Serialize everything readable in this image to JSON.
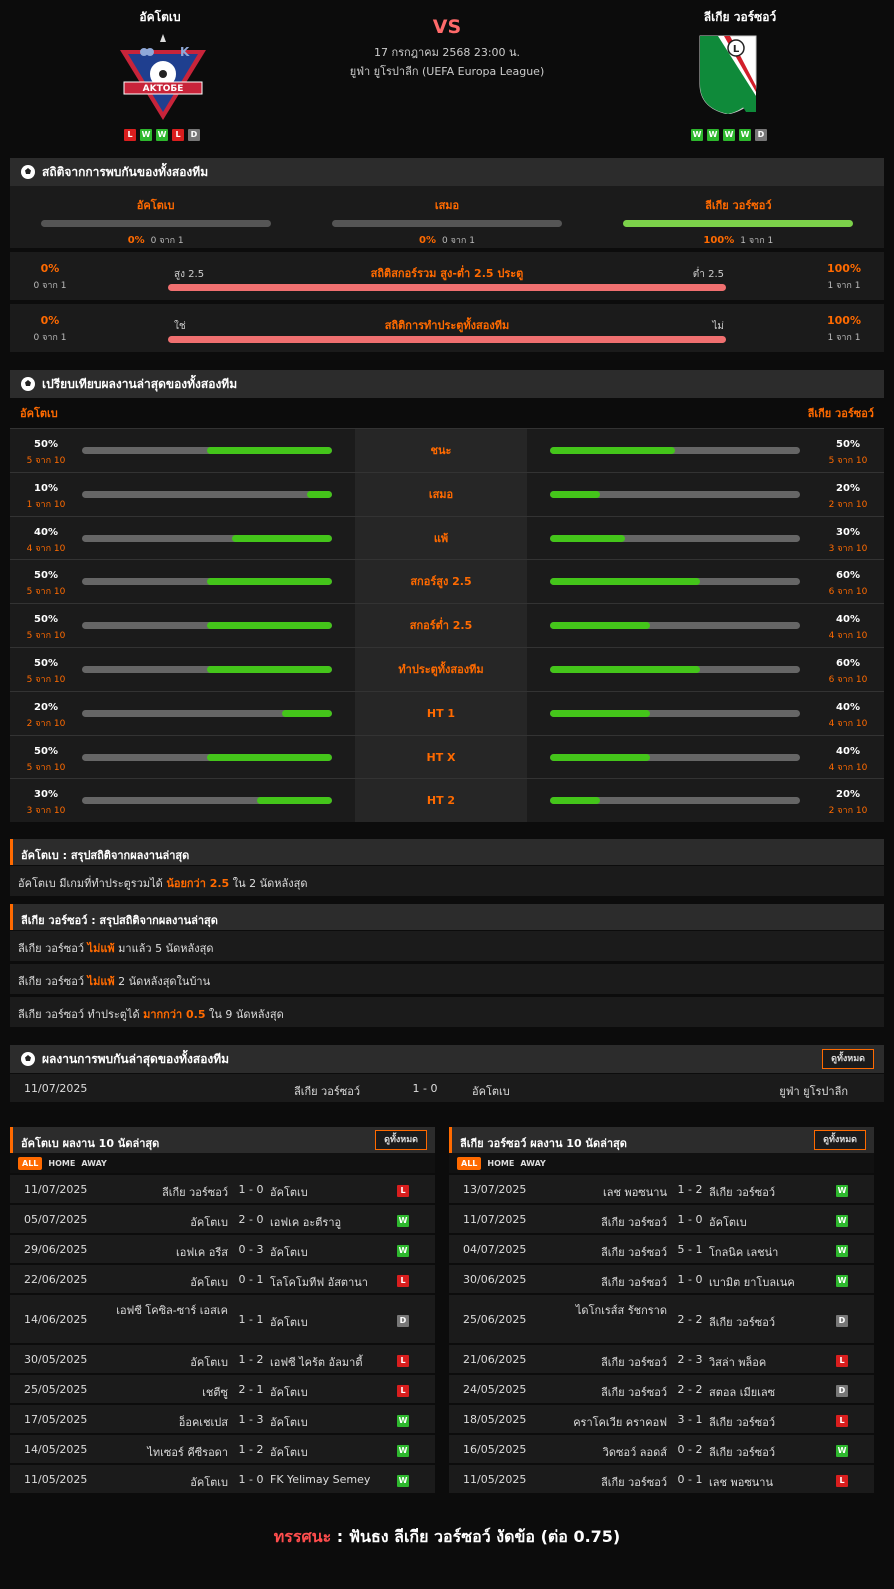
{
  "header": {
    "home_name": "อัคโตเบ",
    "away_name": "ลีเกีย วอร์ซอว์",
    "vs": "VS",
    "date": "17 กรกฎาคม 2568 23:00 น.",
    "league": "ยูฟ่า ยูโรปาลีก (UEFA Europa League)",
    "home_logo_text": "AKTOБE",
    "home_logo_letter": "K",
    "away_logo_letter": "L",
    "home_form": [
      "L",
      "W",
      "W",
      "L",
      "D"
    ],
    "away_form": [
      "W",
      "W",
      "W",
      "W",
      "D"
    ]
  },
  "h2h": {
    "title": "สถิติจากการพบกันของทั้งสองทีม",
    "cols": [
      {
        "label": "อัคโตเบ",
        "pct": "0%",
        "sub": "0 จาก 1",
        "fill": 0
      },
      {
        "label": "เสมอ",
        "pct": "0%",
        "sub": "0 จาก 1",
        "fill": 0
      },
      {
        "label": "ลีเกีย วอร์ซอว์",
        "pct": "100%",
        "sub": "1 จาก 1",
        "fill": 1
      }
    ],
    "goals": {
      "title": "สถิติสกอร์รวม สูง-ต่ำ 2.5 ประตู",
      "left_pct": "0%",
      "left_sub": "0 จาก 1",
      "left_label": "สูง 2.5",
      "right_pct": "100%",
      "right_sub": "1 จาก 1",
      "right_label": "ต่ำ 2.5"
    },
    "btts": {
      "title": "สถิติการทำประตูทั้งสองทีม",
      "left_pct": "0%",
      "left_sub": "0 จาก 1",
      "left_label": "ใช่",
      "right_pct": "100%",
      "right_sub": "1 จาก 1",
      "right_label": "ไม่"
    }
  },
  "compare": {
    "title": "เปรียบเทียบผลงานล่าสุดของทั้งสองทีม",
    "home": "อัคโตเบ",
    "away": "ลีเกีย วอร์ซอว์",
    "rows": [
      {
        "label": "ชนะ",
        "hp": "50%",
        "hs": "5 จาก 10",
        "hv": 0.5,
        "ap": "50%",
        "as": "5 จาก 10",
        "av": 0.5
      },
      {
        "label": "เสมอ",
        "hp": "10%",
        "hs": "1 จาก 10",
        "hv": 0.1,
        "ap": "20%",
        "as": "2 จาก 10",
        "av": 0.2
      },
      {
        "label": "แพ้",
        "hp": "40%",
        "hs": "4 จาก 10",
        "hv": 0.4,
        "ap": "30%",
        "as": "3 จาก 10",
        "av": 0.3
      },
      {
        "label": "สกอร์สูง 2.5",
        "hp": "50%",
        "hs": "5 จาก 10",
        "hv": 0.5,
        "ap": "60%",
        "as": "6 จาก 10",
        "av": 0.6
      },
      {
        "label": "สกอร์ต่ำ 2.5",
        "hp": "50%",
        "hs": "5 จาก 10",
        "hv": 0.5,
        "ap": "40%",
        "as": "4 จาก 10",
        "av": 0.4
      },
      {
        "label": "ทำประตูทั้งสองทีม",
        "hp": "50%",
        "hs": "5 จาก 10",
        "hv": 0.5,
        "ap": "60%",
        "as": "6 จาก 10",
        "av": 0.6
      },
      {
        "label": "HT 1",
        "hp": "20%",
        "hs": "2 จาก 10",
        "hv": 0.2,
        "ap": "40%",
        "as": "4 จาก 10",
        "av": 0.4
      },
      {
        "label": "HT X",
        "hp": "50%",
        "hs": "5 จาก 10",
        "hv": 0.5,
        "ap": "40%",
        "as": "4 จาก 10",
        "av": 0.4
      },
      {
        "label": "HT 2",
        "hp": "30%",
        "hs": "3 จาก 10",
        "hv": 0.3,
        "ap": "20%",
        "as": "2 จาก 10",
        "av": 0.2
      }
    ]
  },
  "summary_home": {
    "title": "อัคโตเบ : สรุปสถิติจากผลงานล่าสุด",
    "lines": [
      {
        "pre": "อัคโตเบ  มีเกมที่ทำประตูรวมได้ ",
        "hl": "น้อยกว่า  2.5",
        "post": "  ใน 2 นัดหลังสุด"
      }
    ]
  },
  "summary_away": {
    "title": "ลีเกีย วอร์ซอว์ : สรุปสถิติจากผลงานล่าสุด",
    "lines": [
      {
        "pre": "ลีเกีย วอร์ซอว์  ",
        "hl": "ไม่แพ้",
        "post": "  มาแล้ว 5 นัดหลังสุด"
      },
      {
        "pre": "ลีเกีย วอร์ซอว์  ",
        "hl": "ไม่แพ้",
        "post": "  2  นัดหลังสุดในบ้าน"
      },
      {
        "pre": "ลีเกีย วอร์ซอว์  ทำประตูได้  ",
        "hl": "มากกว่า  0.5",
        "post": "  ใน 9 นัดหลังสุด"
      }
    ]
  },
  "recent_h2h": {
    "title": "ผลงานการพบกันล่าสุดของทั้งสองทีม",
    "btn": "ดูทั้งหมด",
    "date": "11/07/2025",
    "home": "ลีเกีย วอร์ซอว์",
    "score": "1 - 0",
    "away": "อัคโตเบ",
    "league": "ยูฟ่า ยูโรปาลีก"
  },
  "home_last10": {
    "title": "อัคโตเบ ผลงาน 10 นัดล่าสุด",
    "btn": "ดูทั้งหมด",
    "tabs": [
      "ALL",
      "HOME",
      "AWAY"
    ],
    "rows": [
      {
        "d": "11/07/2025",
        "h": "ลีเกีย วอร์ซอว์",
        "s": "1 - 0",
        "a": "อัคโตเบ",
        "r": "L"
      },
      {
        "d": "05/07/2025",
        "h": "อัคโตเบ",
        "s": "2 - 0",
        "a": "เอฟเค อะตีราอู",
        "r": "W"
      },
      {
        "d": "29/06/2025",
        "h": "เอฟเค อรีส",
        "s": "0 - 3",
        "a": "อัคโตเบ",
        "r": "W"
      },
      {
        "d": "22/06/2025",
        "h": "อัคโตเบ",
        "s": "0 - 1",
        "a": "โลโคโมทีฟ อัสตานา",
        "r": "L"
      },
      {
        "d": "14/06/2025",
        "h": "เอฟซี โคซิล-ซาร์ เอสเค",
        "s": "1 - 1",
        "a": "อัคโตเบ",
        "r": "D"
      },
      {
        "d": "30/05/2025",
        "h": "อัคโตเบ",
        "s": "1 - 2",
        "a": "เอฟซี ไคร้ต อัลมาตี้",
        "r": "L"
      },
      {
        "d": "25/05/2025",
        "h": "เชตีซู",
        "s": "2 - 1",
        "a": "อัคโตเบ",
        "r": "L"
      },
      {
        "d": "17/05/2025",
        "h": "อ็อคเชเปส",
        "s": "1 - 3",
        "a": "อัคโตเบ",
        "r": "W"
      },
      {
        "d": "14/05/2025",
        "h": "ไทเซอร์ คีซีรอดา",
        "s": "1 - 2",
        "a": "อัคโตเบ",
        "r": "W"
      },
      {
        "d": "11/05/2025",
        "h": "อัคโตเบ",
        "s": "1 - 0",
        "a": "FK Yelimay Semey",
        "r": "W"
      }
    ]
  },
  "away_last10": {
    "title": "ลีเกีย วอร์ซอว์ ผลงาน 10 นัดล่าสุด",
    "btn": "ดูทั้งหมด",
    "tabs": [
      "ALL",
      "HOME",
      "AWAY"
    ],
    "rows": [
      {
        "d": "13/07/2025",
        "h": "เลช พอซนาน",
        "s": "1 - 2",
        "a": "ลีเกีย วอร์ซอว์",
        "r": "W"
      },
      {
        "d": "11/07/2025",
        "h": "ลีเกีย วอร์ซอว์",
        "s": "1 - 0",
        "a": "อัคโตเบ",
        "r": "W"
      },
      {
        "d": "04/07/2025",
        "h": "ลีเกีย วอร์ซอว์",
        "s": "5 - 1",
        "a": "โกลนิค เลชน่า",
        "r": "W"
      },
      {
        "d": "30/06/2025",
        "h": "ลีเกีย วอร์ซอว์",
        "s": "1 - 0",
        "a": "เบามิต ยาโบลเนค",
        "r": "W"
      },
      {
        "d": "25/06/2025",
        "h": "ไดโกเรส์ส รัชกราด",
        "s": "2 - 2",
        "a": "ลีเกีย วอร์ซอว์",
        "r": "D"
      },
      {
        "d": "21/06/2025",
        "h": "ลีเกีย วอร์ซอว์",
        "s": "2 - 3",
        "a": "วิสล่า พล็อค",
        "r": "L"
      },
      {
        "d": "24/05/2025",
        "h": "ลีเกีย วอร์ซอว์",
        "s": "2 - 2",
        "a": "สตอล เมียเลซ",
        "r": "D"
      },
      {
        "d": "18/05/2025",
        "h": "คราโคเวีย คราคอฟ",
        "s": "3 - 1",
        "a": "ลีเกีย วอร์ซอว์",
        "r": "L"
      },
      {
        "d": "16/05/2025",
        "h": "วิดซอว์ ลอดส์",
        "s": "0 - 2",
        "a": "ลีเกีย วอร์ซอว์",
        "r": "W"
      },
      {
        "d": "11/05/2025",
        "h": "ลีเกีย วอร์ซอว์",
        "s": "0 - 1",
        "a": "เลช พอซนาน",
        "r": "L"
      }
    ]
  },
  "verdict": {
    "label": "ทรรศนะ",
    "sep": " :  ",
    "text": "ฟันธง ลีเกีย วอร์ซอว์ งัดข้อ (ต่อ 0.75)"
  },
  "colors": {
    "accent": "#ff6a00",
    "win": "#2eb82e",
    "loss": "#d91e1e",
    "draw": "#777777",
    "bar_fill": "#44c51a"
  }
}
